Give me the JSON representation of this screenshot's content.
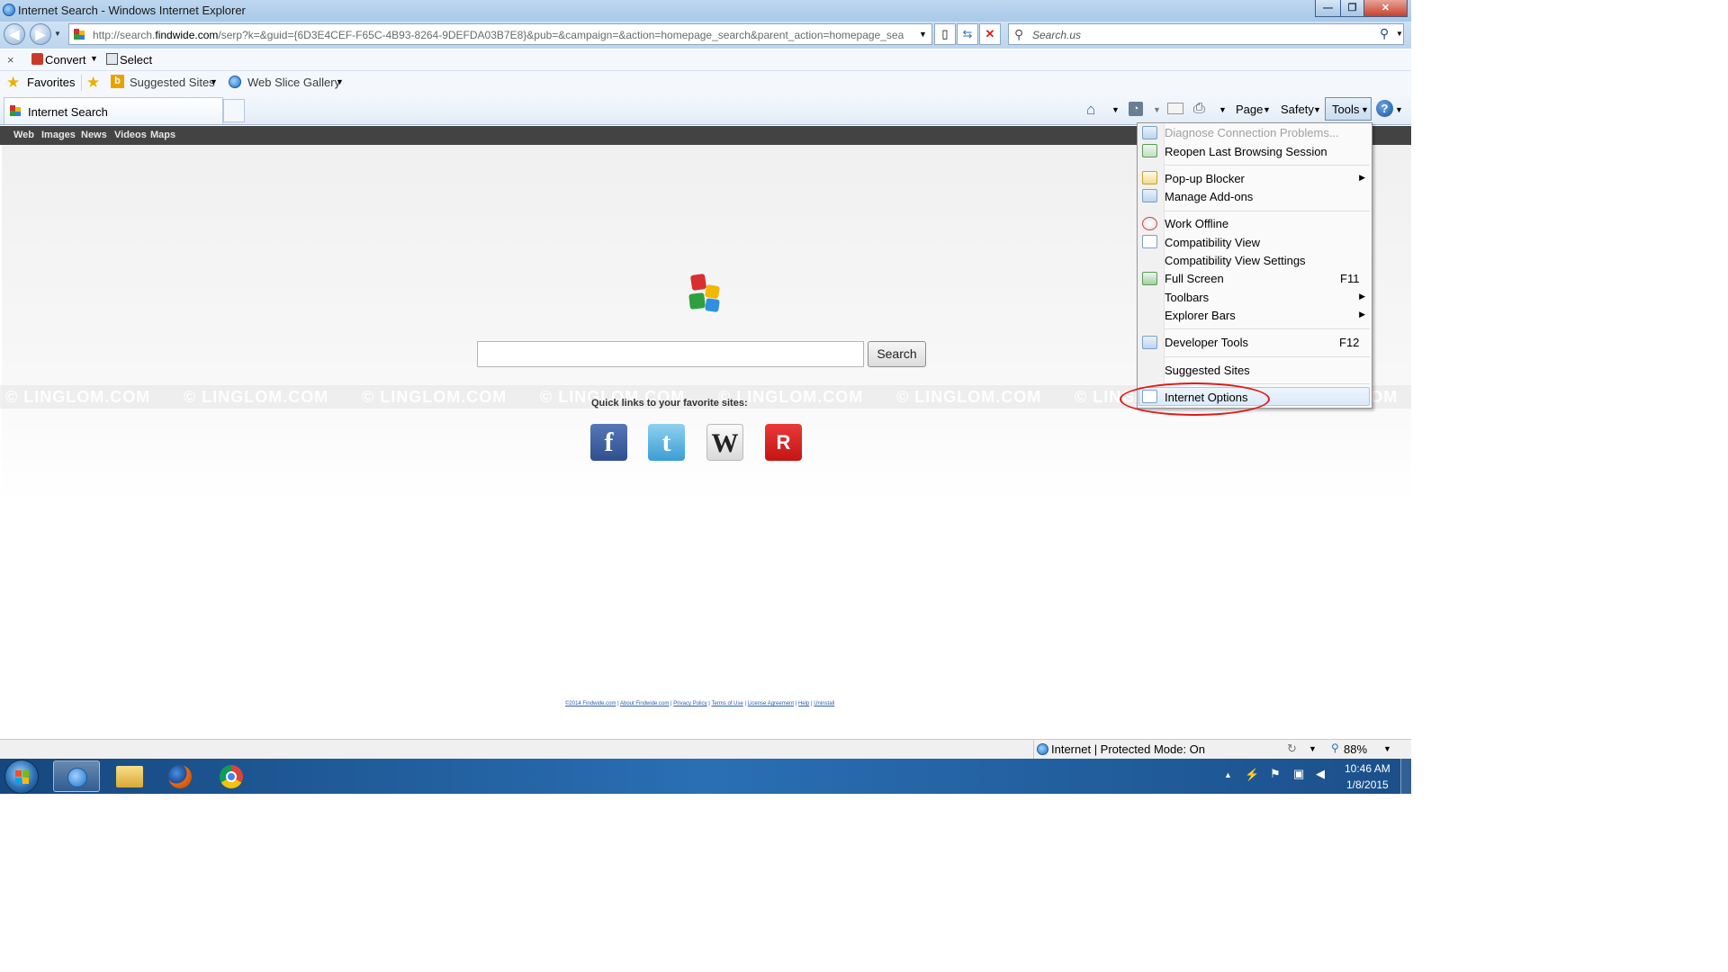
{
  "window": {
    "title": "Internet Search - Windows Internet Explorer"
  },
  "address": {
    "url_prefix": "http://search.",
    "url_domain": "findwide.com",
    "url_rest": "/serp?k=&guid={6D3E4CEF-F65C-4B93-8264-9DEFDA03B7E8}&pub=&campaign=&action=homepage_search&parent_action=homepage_sea"
  },
  "search_box": {
    "placeholder": "Search.us"
  },
  "command_bar": {
    "close": "×",
    "convert": "Convert",
    "select": "Select"
  },
  "favorites_bar": {
    "favorites": "Favorites",
    "suggested_sites": "Suggested Sites",
    "web_slice_gallery": "Web Slice Gallery"
  },
  "tab": {
    "title": "Internet Search"
  },
  "toolbar": {
    "page": "Page",
    "safety": "Safety",
    "tools": "Tools"
  },
  "site_nav": [
    "Web",
    "Images",
    "News",
    "Videos",
    "Maps"
  ],
  "main": {
    "search_button": "Search",
    "quick_links_label": "Quick links to your favorite sites:",
    "watermark": "© LINGLOM.COM",
    "quick_links": [
      {
        "name": "facebook",
        "glyph": "f",
        "color": "#3b5998"
      },
      {
        "name": "twitter",
        "glyph": "t",
        "color": "#4aa8d8"
      },
      {
        "name": "wikipedia",
        "glyph": "W",
        "color": "#f2f2f2"
      },
      {
        "name": "shopping",
        "glyph": "R",
        "color": "#d71921"
      }
    ],
    "footer_links": [
      "©2014 Findwide.com",
      "About Findwide.com",
      "Privacy Policy",
      "Terms of Use",
      "License Agreement",
      "Help",
      "Uninstall"
    ]
  },
  "status_bar": {
    "zone": "Internet | Protected Mode: On",
    "zoom": "88%"
  },
  "tools_menu": {
    "items": [
      {
        "label": "Diagnose Connection Problems...",
        "disabled": true
      },
      {
        "label": "Reopen Last Browsing Session"
      },
      {
        "label": "Pop-up Blocker",
        "submenu": true
      },
      {
        "label": "Manage Add-ons"
      },
      {
        "label": "Work Offline"
      },
      {
        "label": "Compatibility View"
      },
      {
        "label": "Compatibility View Settings"
      },
      {
        "label": "Full Screen",
        "shortcut": "F11"
      },
      {
        "label": "Toolbars",
        "submenu": true
      },
      {
        "label": "Explorer Bars",
        "submenu": true
      },
      {
        "label": "Developer Tools",
        "shortcut": "F12"
      },
      {
        "label": "Suggested Sites"
      },
      {
        "label": "Internet Options",
        "highlighted": true
      }
    ]
  },
  "taskbar": {
    "time": "10:46 AM",
    "date": "1/8/2015"
  }
}
